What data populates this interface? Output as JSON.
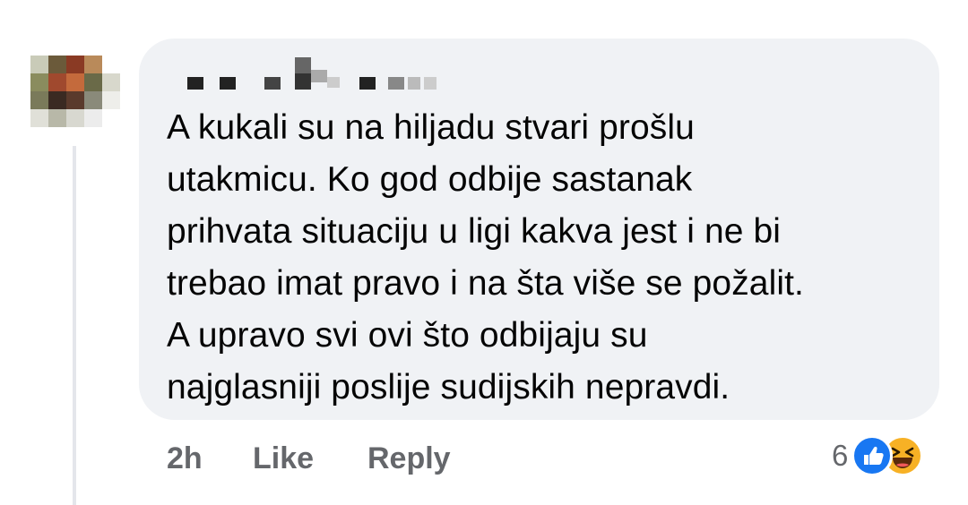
{
  "comment": {
    "author_name": "",
    "lines": [
      "A kukali su na hiljadu stvari prošlu",
      "utakmicu. Ko god odbije sastanak",
      "prihvata situaciju u ligi kakva jest i ne bi",
      "trebao imat pravo i na šta više se požalit.",
      "A upravo svi ovi što odbijaju su",
      "najglasniji poslije sudijskih nepravdi."
    ],
    "timestamp": "2h",
    "like_label": "Like",
    "reply_label": "Reply",
    "reaction_count": "6",
    "reaction_icons": [
      "like-icon",
      "haha-icon"
    ]
  },
  "colors": {
    "bubble": "#f0f2f5",
    "text": "#050505",
    "meta": "#65676b",
    "like_blue": "#1877f2",
    "haha_yellow": "#f7b125"
  }
}
